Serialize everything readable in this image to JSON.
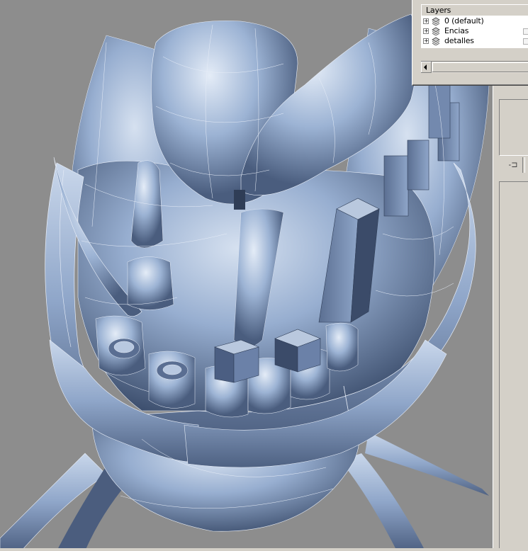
{
  "layers_panel": {
    "title": "Layers",
    "layers": [
      {
        "name": "0 (default)",
        "expanded": false
      },
      {
        "name": "Encias",
        "expanded": false
      },
      {
        "name": "detalles",
        "expanded": false
      }
    ]
  },
  "icons": {
    "expand": "plus-box-icon",
    "layer": "layer-stack-icon",
    "pin": "pin-icon",
    "scroll_left": "scroll-left-arrow-icon",
    "dropdown": "chevron-down-icon"
  },
  "glyphs": {
    "expander": "+",
    "pin": "-⊐",
    "dropdown": "▾"
  },
  "colors": {
    "viewport_background": "#8d8d8d",
    "model_shade": "#8ea6c8",
    "model_highlight": "#d8e4f2",
    "wireframe": "#e8eef8",
    "panel_face": "#d4d0c8"
  }
}
